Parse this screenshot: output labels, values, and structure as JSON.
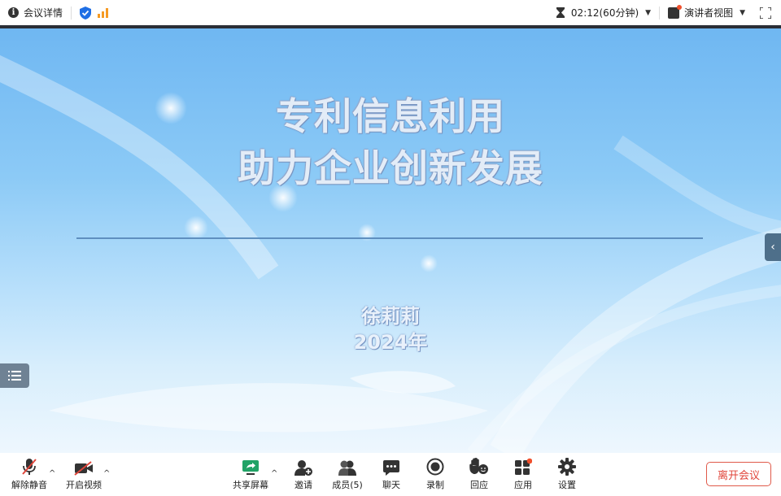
{
  "topbar": {
    "meeting_info_label": "会议详情",
    "info_glyph": "i",
    "timer": "02:12(60分钟)",
    "presenter_view_label": "演讲者视图"
  },
  "slide": {
    "title_line1": "专利信息利用",
    "title_line2": "助力企业创新发展",
    "author": "徐莉莉",
    "year": "2024年"
  },
  "toolbar": {
    "unmute_label": "解除静音",
    "start_video_label": "开启视频",
    "share_screen_label": "共享屏幕",
    "invite_label": "邀请",
    "members_label": "成员(5)",
    "chat_label": "聊天",
    "record_label": "录制",
    "react_label": "回应",
    "apps_label": "应用",
    "settings_label": "设置",
    "leave_label": "离开会议"
  },
  "colors": {
    "accent_leave": "#e0453a",
    "share_green": "#21a366",
    "notify_red": "#f0502d",
    "signal_orange": "#f59a23",
    "shield_blue": "#1f6fe5"
  },
  "icons": [
    "info-icon",
    "shield-icon",
    "signal-icon",
    "hourglass-icon",
    "presenter-view-icon",
    "fullscreen-icon",
    "mic-muted-icon",
    "video-off-icon",
    "share-screen-icon",
    "invite-icon",
    "members-icon",
    "chat-icon",
    "record-icon",
    "react-icon",
    "apps-icon",
    "settings-icon",
    "chevron-left-icon",
    "list-icon"
  ]
}
